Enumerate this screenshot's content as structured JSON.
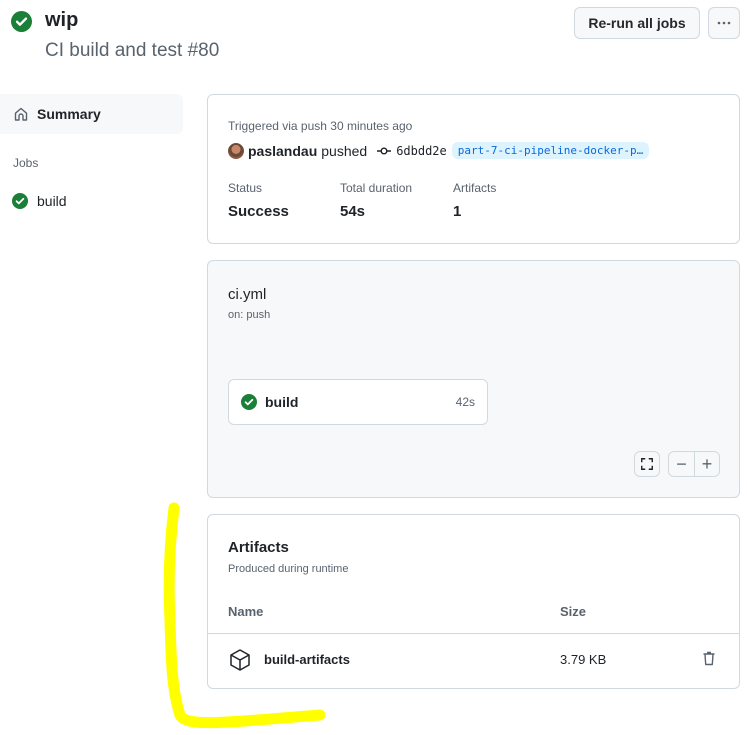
{
  "header": {
    "title": "wip",
    "subtitle": "CI build and test #80",
    "status_icon": "check-circle-fill-icon",
    "rerun_label": "Re-run all jobs",
    "more_label": "···"
  },
  "sidebar": {
    "summary_label": "Summary",
    "jobs_heading": "Jobs",
    "jobs": [
      {
        "label": "build",
        "status": "success"
      }
    ]
  },
  "summary": {
    "triggered": "Triggered via push 30 minutes ago",
    "actor": "paslandau",
    "action": "pushed",
    "commit_sha": "6dbdd2e",
    "branch": "part-7-ci-pipeline-docker-p…",
    "stats": [
      {
        "label": "Status",
        "value": "Success"
      },
      {
        "label": "Total duration",
        "value": "54s"
      },
      {
        "label": "Artifacts",
        "value": "1"
      }
    ]
  },
  "workflow": {
    "file": "ci.yml",
    "trigger": "on: push",
    "jobs": [
      {
        "name": "build",
        "duration": "42s",
        "status": "success"
      }
    ],
    "zoom_out_label": "−",
    "zoom_in_label": "+"
  },
  "artifacts": {
    "title": "Artifacts",
    "subtitle": "Produced during runtime",
    "columns": {
      "name": "Name",
      "size": "Size"
    },
    "rows": [
      {
        "name": "build-artifacts",
        "size": "3.79 KB"
      }
    ]
  },
  "colors": {
    "success": "#1a7f37",
    "annotation": "#ffff00",
    "link": "#0969da"
  }
}
